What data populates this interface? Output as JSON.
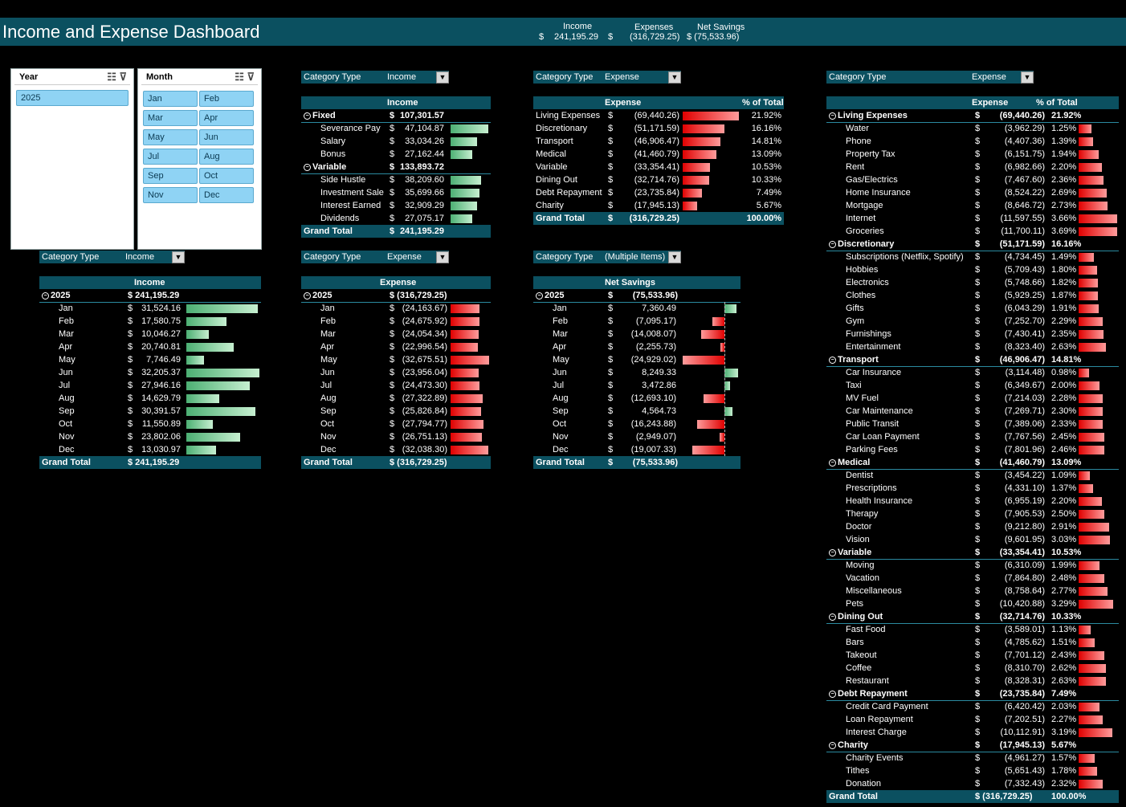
{
  "title": "Income and Expense Dashboard",
  "kpi": {
    "income_label": "Income",
    "income_cur": "$",
    "income_value": "241,195.29",
    "expenses_label": "Expenses",
    "expenses_cur": "$",
    "expenses_value": "(316,729.25)",
    "net_label": "Net Savings",
    "net_value": "$ (75,533.96)"
  },
  "year_slicer": {
    "title": "Year",
    "items": [
      "2025"
    ]
  },
  "month_slicer": {
    "title": "Month",
    "items": [
      "Jan",
      "Feb",
      "Mar",
      "Apr",
      "May",
      "Jun",
      "Jul",
      "Aug",
      "Sep",
      "Oct",
      "Nov",
      "Dec"
    ]
  },
  "filters": {
    "f1": {
      "label": "Category Type",
      "value": "Income"
    },
    "f2": {
      "label": "Category Type",
      "value": "Expense"
    },
    "f3": {
      "label": "Category Type",
      "value": "Expense"
    },
    "f4": {
      "label": "Category Type",
      "value": "Income"
    },
    "f5": {
      "label": "Category Type",
      "value": "Expense"
    },
    "f6": {
      "label": "Category Type",
      "value": "(Multiple Items)"
    }
  },
  "income_by_category": {
    "header": "Income",
    "rows": [
      {
        "label": "Fixed",
        "cur": "$",
        "value": "107,301.57",
        "group": true
      },
      {
        "label": "Severance Pay",
        "cur": "$",
        "value": "47,104.87",
        "amt": 47104.87
      },
      {
        "label": "Salary",
        "cur": "$",
        "value": "33,034.26",
        "amt": 33034.26
      },
      {
        "label": "Bonus",
        "cur": "$",
        "value": "27,162.44",
        "amt": 27162.44
      },
      {
        "label": "Variable",
        "cur": "$",
        "value": "133,893.72",
        "group": true
      },
      {
        "label": "Side Hustle",
        "cur": "$",
        "value": "38,209.60",
        "amt": 38209.6
      },
      {
        "label": "Investment Sale",
        "cur": "$",
        "value": "35,699.66",
        "amt": 35699.66
      },
      {
        "label": "Interest Earned",
        "cur": "$",
        "value": "32,909.29",
        "amt": 32909.29
      },
      {
        "label": "Dividends",
        "cur": "$",
        "value": "27,075.17",
        "amt": 27075.17
      }
    ],
    "total_label": "Grand Total",
    "total_cur": "$",
    "total_value": "241,195.29"
  },
  "expense_by_type": {
    "header": "Expense",
    "pct_header": "% of Total",
    "rows": [
      {
        "label": "Living Expenses",
        "cur": "$",
        "value": "(69,440.26)",
        "pct": "21.92%",
        "amt": 69440.26
      },
      {
        "label": "Discretionary",
        "cur": "$",
        "value": "(51,171.59)",
        "pct": "16.16%",
        "amt": 51171.59
      },
      {
        "label": "Transport",
        "cur": "$",
        "value": "(46,906.47)",
        "pct": "14.81%",
        "amt": 46906.47
      },
      {
        "label": "Medical",
        "cur": "$",
        "value": "(41,460.79)",
        "pct": "13.09%",
        "amt": 41460.79
      },
      {
        "label": "Variable",
        "cur": "$",
        "value": "(33,354.41)",
        "pct": "10.53%",
        "amt": 33354.41
      },
      {
        "label": "Dining Out",
        "cur": "$",
        "value": "(32,714.76)",
        "pct": "10.33%",
        "amt": 32714.76
      },
      {
        "label": "Debt Repayment",
        "cur": "$",
        "value": "(23,735.84)",
        "pct": "7.49%",
        "amt": 23735.84
      },
      {
        "label": "Charity",
        "cur": "$",
        "value": "(17,945.13)",
        "pct": "5.67%",
        "amt": 17945.13
      }
    ],
    "total_label": "Grand Total",
    "total_cur": "$",
    "total_value": "(316,729.25)",
    "total_pct": "100.00%"
  },
  "monthly_income": {
    "header": "Income",
    "year": "2025",
    "year_value": "$ 241,195.29",
    "rows": [
      {
        "label": "Jan",
        "value": "31,524.16",
        "amt": 31524.16
      },
      {
        "label": "Feb",
        "value": "17,580.75",
        "amt": 17580.75
      },
      {
        "label": "Mar",
        "value": "10,046.27",
        "amt": 10046.27
      },
      {
        "label": "Apr",
        "value": "20,740.81",
        "amt": 20740.81
      },
      {
        "label": "May",
        "value": "7,746.49",
        "amt": 7746.49
      },
      {
        "label": "Jun",
        "value": "32,205.37",
        "amt": 32205.37
      },
      {
        "label": "Jul",
        "value": "27,946.16",
        "amt": 27946.16
      },
      {
        "label": "Aug",
        "value": "14,629.79",
        "amt": 14629.79
      },
      {
        "label": "Sep",
        "value": "30,391.57",
        "amt": 30391.57
      },
      {
        "label": "Oct",
        "value": "11,550.89",
        "amt": 11550.89
      },
      {
        "label": "Nov",
        "value": "23,802.06",
        "amt": 23802.06
      },
      {
        "label": "Dec",
        "value": "13,030.97",
        "amt": 13030.97
      }
    ],
    "cur": "$",
    "total_label": "Grand Total",
    "total_value": "$ 241,195.29"
  },
  "monthly_expense": {
    "header": "Expense",
    "year": "2025",
    "year_value": "$ (316,729.25)",
    "rows": [
      {
        "label": "Jan",
        "value": "(24,163.67)",
        "amt": 24163.67
      },
      {
        "label": "Feb",
        "value": "(24,675.92)",
        "amt": 24675.92
      },
      {
        "label": "Mar",
        "value": "(24,054.34)",
        "amt": 24054.34
      },
      {
        "label": "Apr",
        "value": "(22,996.54)",
        "amt": 22996.54
      },
      {
        "label": "May",
        "value": "(32,675.51)",
        "amt": 32675.51
      },
      {
        "label": "Jun",
        "value": "(23,956.04)",
        "amt": 23956.04
      },
      {
        "label": "Jul",
        "value": "(24,473.30)",
        "amt": 24473.3
      },
      {
        "label": "Aug",
        "value": "(27,322.89)",
        "amt": 27322.89
      },
      {
        "label": "Sep",
        "value": "(25,826.84)",
        "amt": 25826.84
      },
      {
        "label": "Oct",
        "value": "(27,794.77)",
        "amt": 27794.77
      },
      {
        "label": "Nov",
        "value": "(26,751.13)",
        "amt": 26751.13
      },
      {
        "label": "Dec",
        "value": "(32,038.30)",
        "amt": 32038.3
      }
    ],
    "cur": "$",
    "total_label": "Grand Total",
    "total_value": "$ (316,729.25)"
  },
  "monthly_net": {
    "header": "Net Savings",
    "year": "2025",
    "year_cur": "$",
    "year_value": "(75,533.96)",
    "rows": [
      {
        "label": "Jan",
        "value": "7,360.49",
        "amt": 7360.49
      },
      {
        "label": "Feb",
        "value": "(7,095.17)",
        "amt": -7095.17
      },
      {
        "label": "Mar",
        "value": "(14,008.07)",
        "amt": -14008.07
      },
      {
        "label": "Apr",
        "value": "(2,255.73)",
        "amt": -2255.73
      },
      {
        "label": "May",
        "value": "(24,929.02)",
        "amt": -24929.02
      },
      {
        "label": "Jun",
        "value": "8,249.33",
        "amt": 8249.33
      },
      {
        "label": "Jul",
        "value": "3,472.86",
        "amt": 3472.86
      },
      {
        "label": "Aug",
        "value": "(12,693.10)",
        "amt": -12693.1
      },
      {
        "label": "Sep",
        "value": "4,564.73",
        "amt": 4564.73
      },
      {
        "label": "Oct",
        "value": "(16,243.88)",
        "amt": -16243.88
      },
      {
        "label": "Nov",
        "value": "(2,949.07)",
        "amt": -2949.07
      },
      {
        "label": "Dec",
        "value": "(19,007.33)",
        "amt": -19007.33
      }
    ],
    "cur": "$",
    "total_label": "Grand Total",
    "total_cur": "$",
    "total_value": "(75,533.96)"
  },
  "expense_detail": {
    "header": "Expense",
    "pct_header": "% of Total",
    "rows": [
      {
        "label": "Living Expenses",
        "value": "(69,440.26)",
        "pct": "21.92%",
        "group": true
      },
      {
        "label": "Water",
        "value": "(3,962.29)",
        "pct": "1.25%",
        "amt": 3962.29
      },
      {
        "label": "Phone",
        "value": "(4,407.36)",
        "pct": "1.39%",
        "amt": 4407.36
      },
      {
        "label": "Property Tax",
        "value": "(6,151.75)",
        "pct": "1.94%",
        "amt": 6151.75
      },
      {
        "label": "Rent",
        "value": "(6,982.66)",
        "pct": "2.20%",
        "amt": 6982.66
      },
      {
        "label": "Gas/Electrics",
        "value": "(7,467.60)",
        "pct": "2.36%",
        "amt": 7467.6
      },
      {
        "label": "Home Insurance",
        "value": "(8,524.22)",
        "pct": "2.69%",
        "amt": 8524.22
      },
      {
        "label": "Mortgage",
        "value": "(8,646.72)",
        "pct": "2.73%",
        "amt": 8646.72
      },
      {
        "label": "Internet",
        "value": "(11,597.55)",
        "pct": "3.66%",
        "amt": 11597.55
      },
      {
        "label": "Groceries",
        "value": "(11,700.11)",
        "pct": "3.69%",
        "amt": 11700.11
      },
      {
        "label": "Discretionary",
        "value": "(51,171.59)",
        "pct": "16.16%",
        "group": true
      },
      {
        "label": "Subscriptions (Netflix, Spotify)",
        "value": "(4,734.45)",
        "pct": "1.49%",
        "amt": 4734.45
      },
      {
        "label": "Hobbies",
        "value": "(5,709.43)",
        "pct": "1.80%",
        "amt": 5709.43
      },
      {
        "label": "Electronics",
        "value": "(5,748.66)",
        "pct": "1.82%",
        "amt": 5748.66
      },
      {
        "label": "Clothes",
        "value": "(5,929.25)",
        "pct": "1.87%",
        "amt": 5929.25
      },
      {
        "label": "Gifts",
        "value": "(6,043.29)",
        "pct": "1.91%",
        "amt": 6043.29
      },
      {
        "label": "Gym",
        "value": "(7,252.70)",
        "pct": "2.29%",
        "amt": 7252.7
      },
      {
        "label": "Furnishings",
        "value": "(7,430.41)",
        "pct": "2.35%",
        "amt": 7430.41
      },
      {
        "label": "Entertainment",
        "value": "(8,323.40)",
        "pct": "2.63%",
        "amt": 8323.4
      },
      {
        "label": "Transport",
        "value": "(46,906.47)",
        "pct": "14.81%",
        "group": true
      },
      {
        "label": "Car Insurance",
        "value": "(3,114.48)",
        "pct": "0.98%",
        "amt": 3114.48
      },
      {
        "label": "Taxi",
        "value": "(6,349.67)",
        "pct": "2.00%",
        "amt": 6349.67
      },
      {
        "label": "MV Fuel",
        "value": "(7,214.03)",
        "pct": "2.28%",
        "amt": 7214.03
      },
      {
        "label": "Car Maintenance",
        "value": "(7,269.71)",
        "pct": "2.30%",
        "amt": 7269.71
      },
      {
        "label": "Public Transit",
        "value": "(7,389.06)",
        "pct": "2.33%",
        "amt": 7389.06
      },
      {
        "label": "Car Loan Payment",
        "value": "(7,767.56)",
        "pct": "2.45%",
        "amt": 7767.56
      },
      {
        "label": "Parking Fees",
        "value": "(7,801.96)",
        "pct": "2.46%",
        "amt": 7801.96
      },
      {
        "label": "Medical",
        "value": "(41,460.79)",
        "pct": "13.09%",
        "group": true
      },
      {
        "label": "Dentist",
        "value": "(3,454.22)",
        "pct": "1.09%",
        "amt": 3454.22
      },
      {
        "label": "Prescriptions",
        "value": "(4,331.10)",
        "pct": "1.37%",
        "amt": 4331.1
      },
      {
        "label": "Health Insurance",
        "value": "(6,955.19)",
        "pct": "2.20%",
        "amt": 6955.19
      },
      {
        "label": "Therapy",
        "value": "(7,905.53)",
        "pct": "2.50%",
        "amt": 7905.53
      },
      {
        "label": "Doctor",
        "value": "(9,212.80)",
        "pct": "2.91%",
        "amt": 9212.8
      },
      {
        "label": "Vision",
        "value": "(9,601.95)",
        "pct": "3.03%",
        "amt": 9601.95
      },
      {
        "label": "Variable",
        "value": "(33,354.41)",
        "pct": "10.53%",
        "group": true
      },
      {
        "label": "Moving",
        "value": "(6,310.09)",
        "pct": "1.99%",
        "amt": 6310.09
      },
      {
        "label": "Vacation",
        "value": "(7,864.80)",
        "pct": "2.48%",
        "amt": 7864.8
      },
      {
        "label": "Miscellaneous",
        "value": "(8,758.64)",
        "pct": "2.77%",
        "amt": 8758.64
      },
      {
        "label": "Pets",
        "value": "(10,420.88)",
        "pct": "3.29%",
        "amt": 10420.88
      },
      {
        "label": "Dining Out",
        "value": "(32,714.76)",
        "pct": "10.33%",
        "group": true
      },
      {
        "label": "Fast Food",
        "value": "(3,589.01)",
        "pct": "1.13%",
        "amt": 3589.01
      },
      {
        "label": "Bars",
        "value": "(4,785.62)",
        "pct": "1.51%",
        "amt": 4785.62
      },
      {
        "label": "Takeout",
        "value": "(7,701.12)",
        "pct": "2.43%",
        "amt": 7701.12
      },
      {
        "label": "Coffee",
        "value": "(8,310.70)",
        "pct": "2.62%",
        "amt": 8310.7
      },
      {
        "label": "Restaurant",
        "value": "(8,328.31)",
        "pct": "2.63%",
        "amt": 8328.31
      },
      {
        "label": "Debt Repayment",
        "value": "(23,735.84)",
        "pct": "7.49%",
        "group": true
      },
      {
        "label": "Credit Card Payment",
        "value": "(6,420.42)",
        "pct": "2.03%",
        "amt": 6420.42
      },
      {
        "label": "Loan Repayment",
        "value": "(7,202.51)",
        "pct": "2.27%",
        "amt": 7202.51
      },
      {
        "label": "Interest Charge",
        "value": "(10,112.91)",
        "pct": "3.19%",
        "amt": 10112.91
      },
      {
        "label": "Charity",
        "value": "(17,945.13)",
        "pct": "5.67%",
        "group": true
      },
      {
        "label": "Charity Events",
        "value": "(4,961.27)",
        "pct": "1.57%",
        "amt": 4961.27
      },
      {
        "label": "Tithes",
        "value": "(5,651.43)",
        "pct": "1.78%",
        "amt": 5651.43
      },
      {
        "label": "Donation",
        "value": "(7,332.43)",
        "pct": "2.32%",
        "amt": 7332.43
      }
    ],
    "cur": "$",
    "total_label": "Grand Total",
    "total_value": "$ (316,729.25)",
    "total_pct": "100.00%"
  },
  "colors": {
    "header": "#0b5060",
    "accent": "#2b8aa0",
    "bar_positive": "#4caf73",
    "bar_negative": "#e00000",
    "slicer_button": "#8fd3f4"
  }
}
